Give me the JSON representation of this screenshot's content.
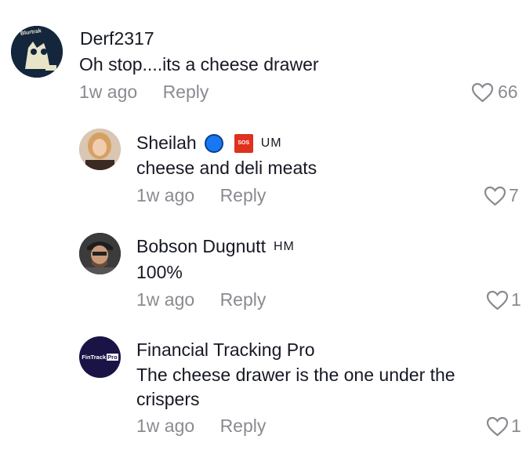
{
  "comments": [
    {
      "name": "Derf2317",
      "text": "Oh stop....its a cheese drawer",
      "time": "1w ago",
      "reply": "Reply",
      "likes": "66",
      "avatar_label": "Blurtrak"
    },
    {
      "name": "Sheilah",
      "badge_sos": "SOS",
      "suffix": "UM",
      "text": "cheese and deli meats",
      "time": "1w ago",
      "reply": "Reply",
      "likes": "7"
    },
    {
      "name": "Bobson Dugnutt",
      "suffix": "HM",
      "text": "100%",
      "time": "1w ago",
      "reply": "Reply",
      "likes": "1"
    },
    {
      "name": "Financial Tracking Pro",
      "text_line1": "The cheese drawer is the one under the",
      "text_line2": "crispers",
      "time": "1w ago",
      "reply": "Reply",
      "likes": "1",
      "avatar_label": "FinTrack",
      "avatar_label_box": "Pro"
    }
  ]
}
